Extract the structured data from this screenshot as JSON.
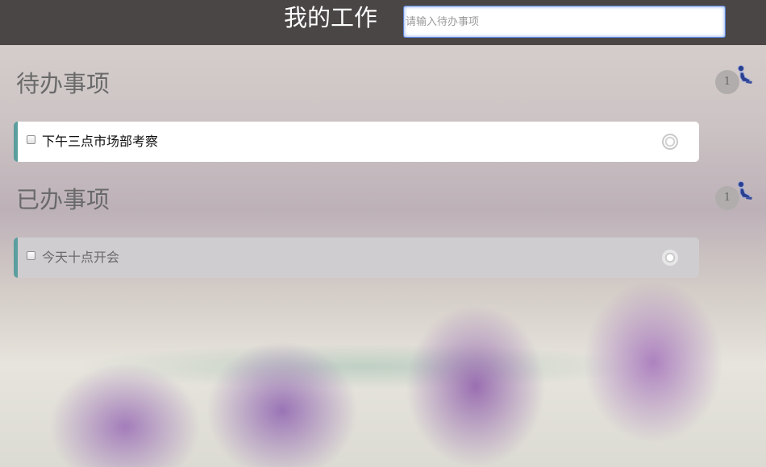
{
  "header": {
    "title": "我的工作",
    "input_placeholder": "请输入待办事项",
    "input_value": ""
  },
  "sections": [
    {
      "title": "待办事项",
      "count": "1",
      "items": [
        {
          "text": "下午三点市场部考察",
          "checked": false
        }
      ]
    },
    {
      "title": "已办事项",
      "count": "1",
      "items": [
        {
          "text": "今天十点开会",
          "checked": false
        }
      ]
    }
  ],
  "icons": {
    "section_corner": "user-icon",
    "item_delete": "circle-button-icon"
  },
  "colors": {
    "header_bg": "#4a4645",
    "accent": "#5a9e9e",
    "badge_bg": "#b1adad"
  }
}
